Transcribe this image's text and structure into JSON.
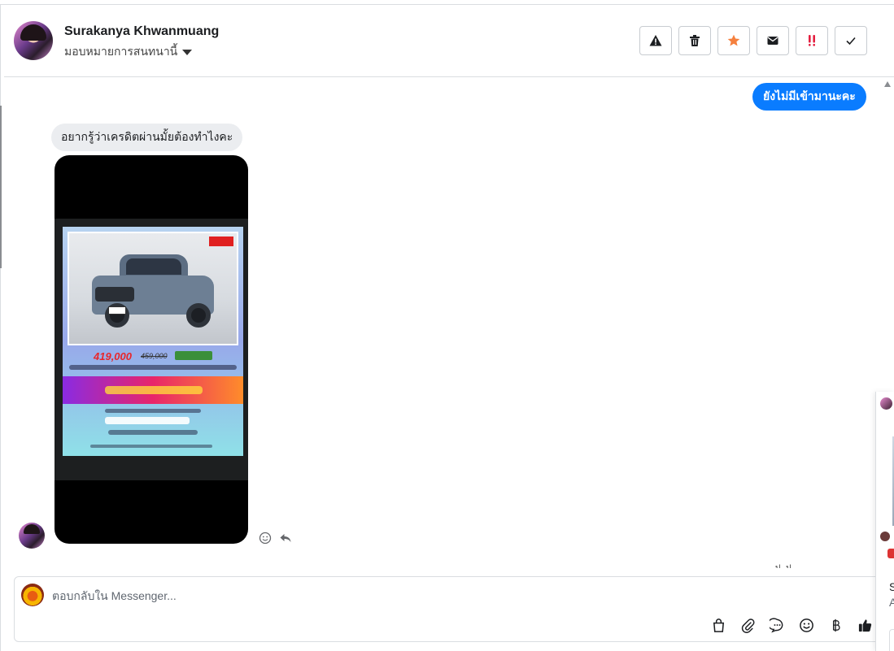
{
  "header": {
    "contact_name": "Surakanya Khwanmuang",
    "assign_label": "มอบหมายการสนทนานี้",
    "actions": [
      {
        "name": "spam",
        "icon": "warning-icon",
        "color": "#1c1e21"
      },
      {
        "name": "delete",
        "icon": "trash-icon",
        "color": "#1c1e21"
      },
      {
        "name": "star",
        "icon": "star-icon",
        "color": "#f5803e"
      },
      {
        "name": "mark-unread",
        "icon": "envelope-icon",
        "color": "#1c1e21"
      },
      {
        "name": "follow-up",
        "icon": "exclamation-icon",
        "color": "#e41e3f"
      },
      {
        "name": "done",
        "icon": "check-icon",
        "color": "#1c1e21"
      }
    ]
  },
  "messages": {
    "outgoing_1": "ยังไม่มีเข้ามานะคะ",
    "incoming_1": "อยากรู้ว่าเครดิตผ่านมั้ยต้องทำไงคะ"
  },
  "ad": {
    "price": "419,000",
    "old_price": "459,000"
  },
  "composer": {
    "placeholder": "ตอบกลับใน Messenger..."
  },
  "side_panel": {
    "line1": "S",
    "line2": "A"
  },
  "colors": {
    "accent": "#0a7cff",
    "bubble_in": "#ebedf0",
    "border": "#dadde1"
  }
}
